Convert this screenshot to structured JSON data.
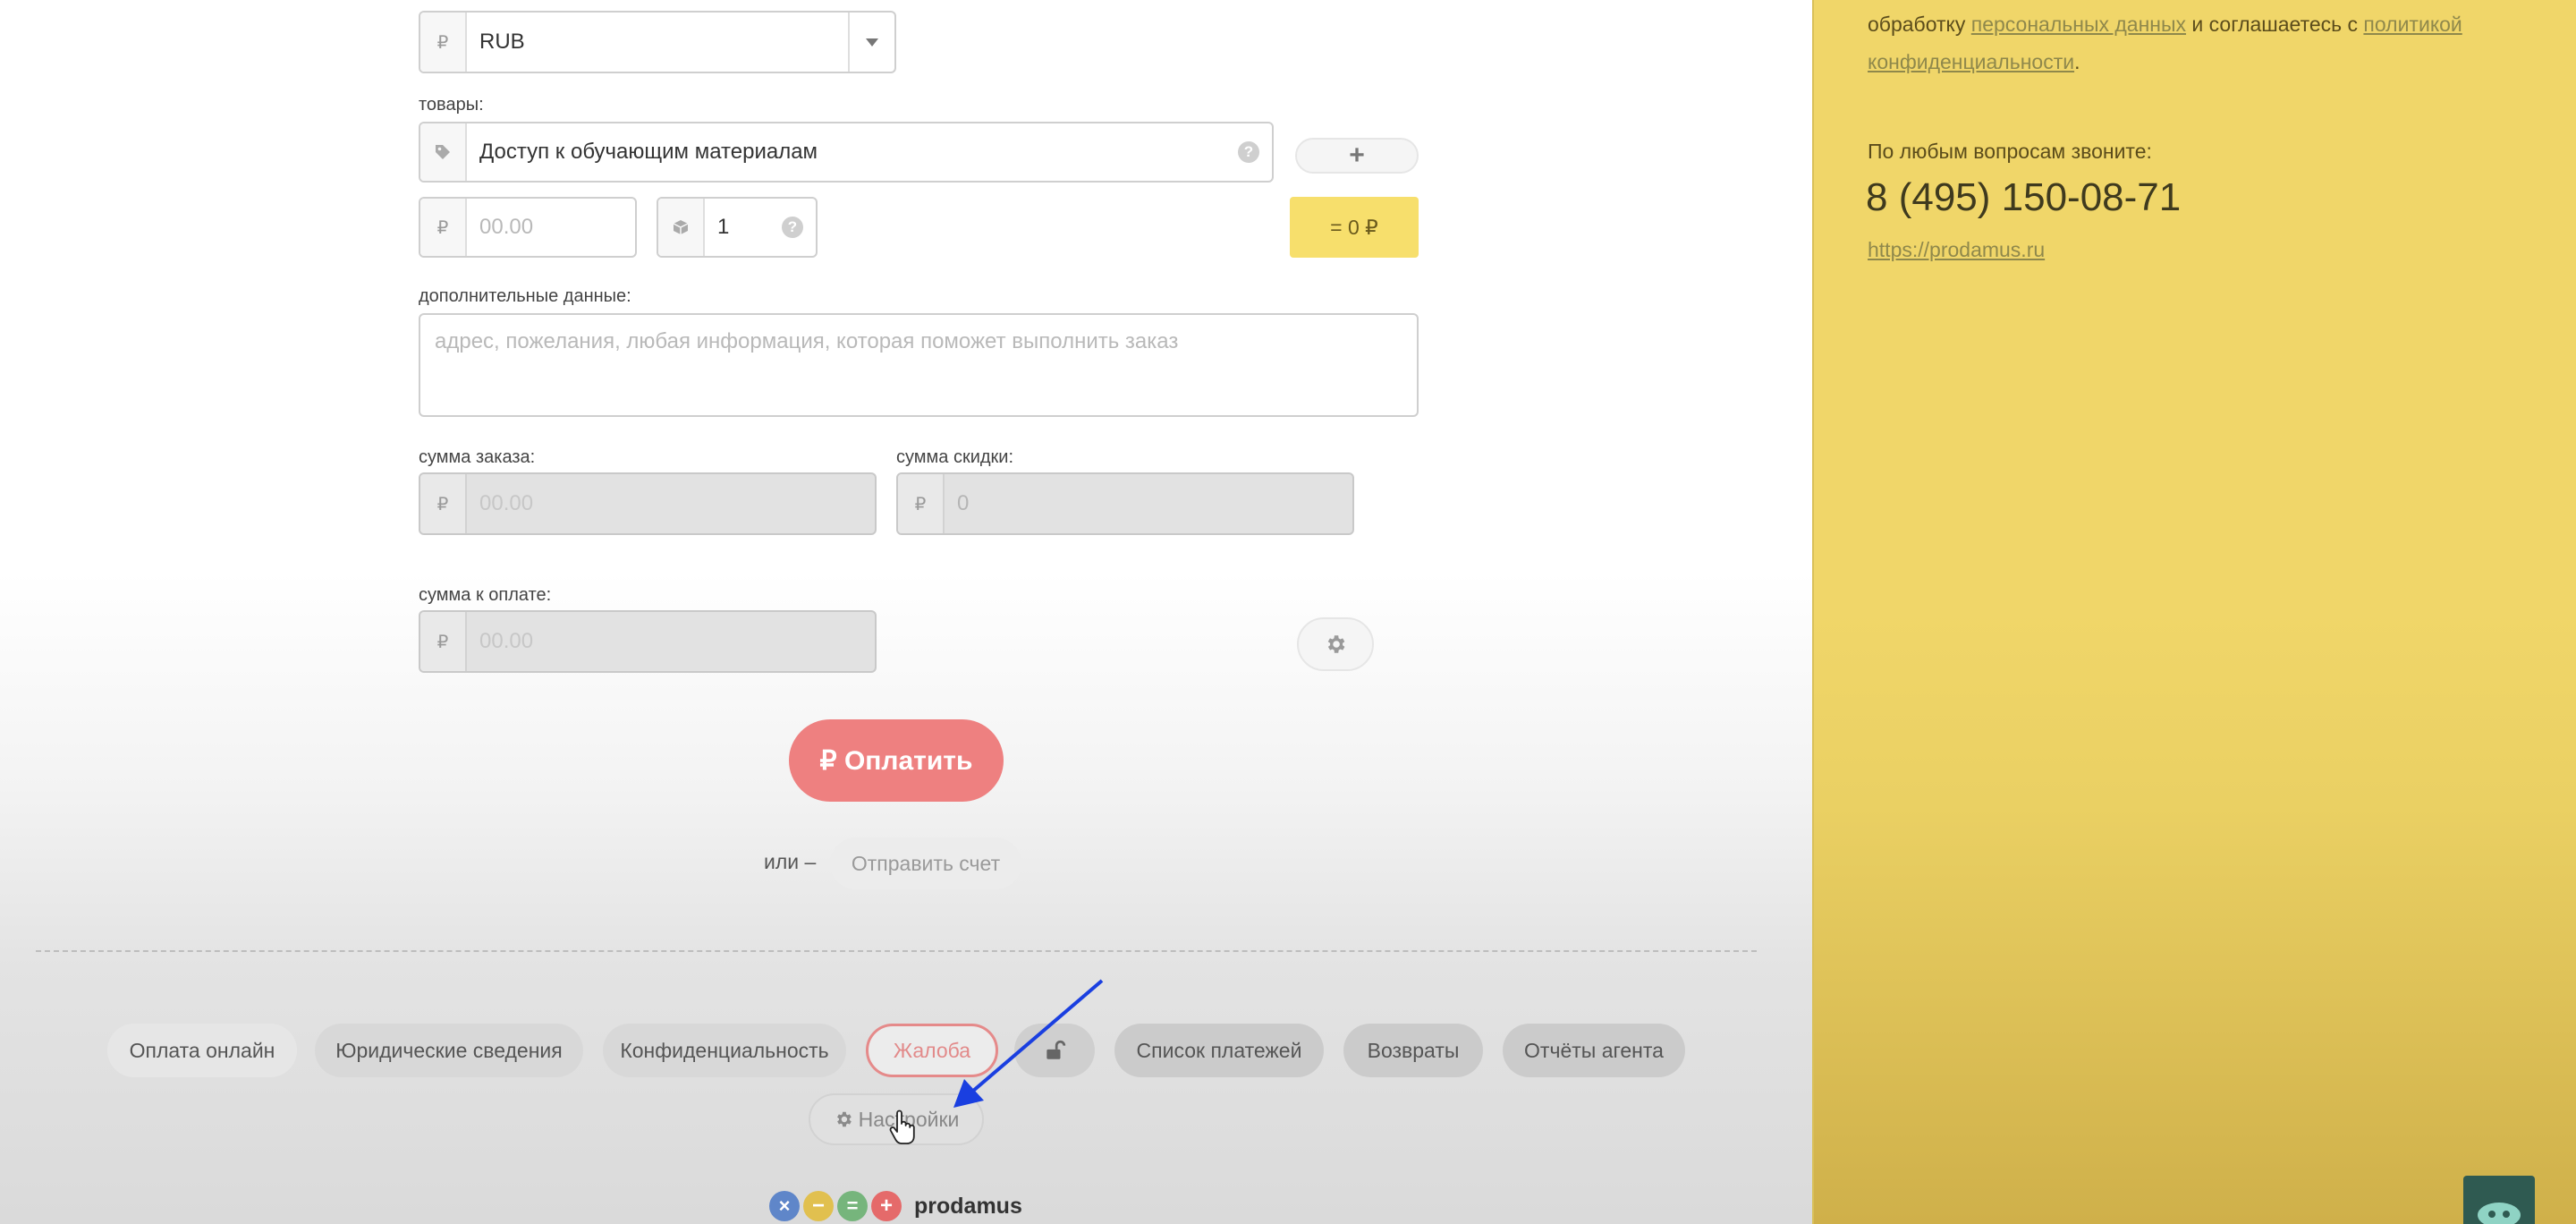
{
  "form": {
    "currency": {
      "icon": "ruble-icon",
      "value": "RUB"
    },
    "products": {
      "label": "товары:",
      "name_value": "Доступ к обучающим материалам",
      "price_placeholder": "00.00",
      "quantity_value": "1",
      "total_badge": "= 0 ₽"
    },
    "additional": {
      "label": "дополнительные данные:",
      "placeholder": "адрес, пожелания, любая информация, которая поможет выполнить заказ"
    },
    "order_sum": {
      "label": "сумма заказа:",
      "placeholder": "00.00"
    },
    "discount_sum": {
      "label": "сумма скидки:",
      "placeholder": "0"
    },
    "pay_sum": {
      "label": "сумма к оплате:",
      "placeholder": "00.00"
    },
    "pay_button": "₽ Оплатить",
    "or_text": "или –",
    "send_invoice_button": "Отправить счет"
  },
  "footer": {
    "links": [
      "Оплата онлайн",
      "Юридические сведения",
      "Конфиденциальность",
      "Жалоба",
      "Список платежей",
      "Возвраты",
      "Отчёты агента"
    ],
    "settings_button": "Настройки",
    "brand": "prodamus"
  },
  "sidebar": {
    "consent_prefix": "обработку",
    "consent_link1": "персональных данных",
    "consent_middle": "и соглашаетесь с",
    "consent_link2": "политикой",
    "consent_link3": "конфиденциальности",
    "contact_label": "По любым вопросам звоните:",
    "phone": "8 (495) 150-08-71",
    "website": "https://prodamus.ru"
  },
  "colors": {
    "accent_red": "#ee8080",
    "sidebar_yellow": "#f0d669",
    "total_badge_yellow": "#f7df6c",
    "annotation_arrow": "#1a3fe0"
  }
}
